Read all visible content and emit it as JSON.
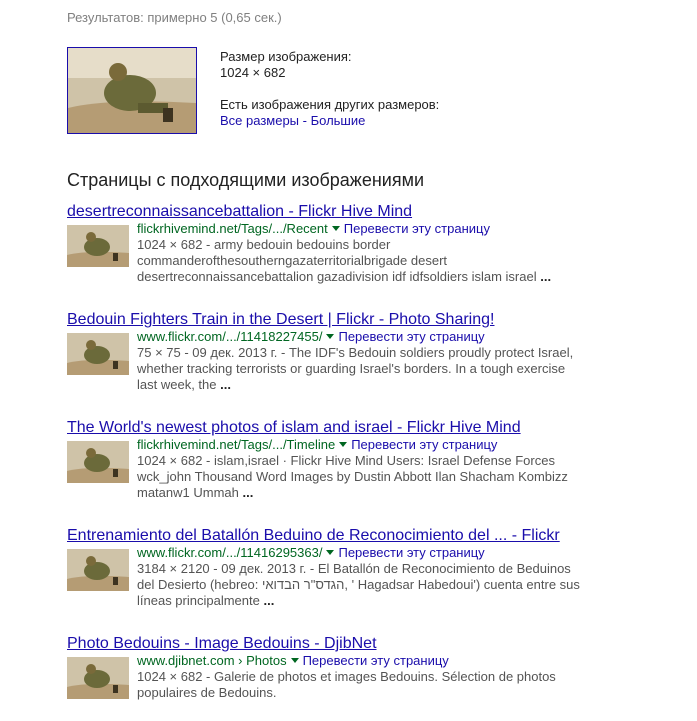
{
  "stats": "Результатов: примерно 5 (0,65 сек.)",
  "image_info": {
    "size_label": "Размер изображения:",
    "size_value": "1024 × 682",
    "other_sizes_label": "Есть изображения других размеров:",
    "all_sizes_link": "Все размеры",
    "separator": " - ",
    "larger_link": "Большие"
  },
  "pages_heading": "Страницы с подходящими изображениями",
  "translate_label": "Перевести эту страницу",
  "results": [
    {
      "title": "desertreconnaissancebattalion - Flickr Hive Mind",
      "url": "flickrhivemind.net/Tags/.../Recent",
      "snippet": "1024 × 682 - army bedouin bedouins border commanderofthesoutherngazaterritorialbrigade desert desertreconnaissancebattalion gazadivision idf idfsoldiers islam israel",
      "ellipsis": "..."
    },
    {
      "title": "Bedouin Fighters Train in the Desert | Flickr - Photo Sharing!",
      "url": "www.flickr.com/.../11418227455/",
      "snippet": "75 × 75 - 09 дек. 2013 г. - The IDF's Bedouin soldiers proudly protect Israel, whether tracking terrorists or guarding Israel's borders. In a tough exercise last week, the",
      "ellipsis": "..."
    },
    {
      "title": "The World's newest photos of islam and israel - Flickr Hive Mind",
      "url": "flickrhivemind.net/Tags/.../Timeline",
      "snippet": "1024 × 682 - islam,israel · Flickr Hive Mind Users: Israel Defense Forces wck_john Thousand Word Images by Dustin Abbott Ilan Shacham Kombizz matanw1 Ummah",
      "ellipsis": "..."
    },
    {
      "title": "Entrenamiento del Batallón Beduino de Reconocimiento del ... - Flickr",
      "url": "www.flickr.com/.../11416295363/",
      "snippet": "3184 × 2120 - 09 дек. 2013 г. - El Batallón de Reconocimiento de Beduinos del Desierto (hebreo: הגדס\"ר הבדואי, ' Hagadsar Habedoui') cuenta entre sus líneas principalmente",
      "ellipsis": "..."
    },
    {
      "title": "Photo Bedouins - Image Bedouins - DjibNet",
      "url": "www.djibnet.com › Photos",
      "snippet": "1024 × 682 - Galerie de photos et images Bedouins. Sélection de photos populaires de Bedouins.",
      "ellipsis": ""
    }
  ]
}
